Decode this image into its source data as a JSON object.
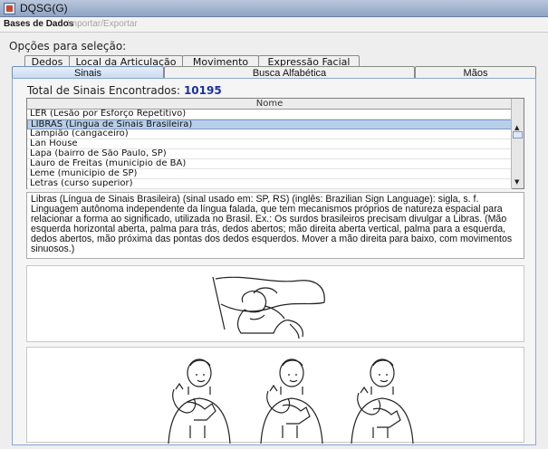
{
  "window": {
    "title": "DQSG(G)"
  },
  "menu": {
    "items": [
      "Bases de Dados",
      "Importar/Exportar"
    ]
  },
  "selection_label": "Opções para seleção:",
  "tabs_row1": [
    "Dedos",
    "Local da Articulação",
    "Movimento",
    "Expressão Facial"
  ],
  "tabs_row2": [
    "Sinais",
    "Busca Alfabética",
    "Mãos"
  ],
  "active_tab": "Sinais",
  "total": {
    "label": "Total de Sinais Encontrados:",
    "value": "10195"
  },
  "table": {
    "column": "Nome",
    "rows": [
      "LER (Lesão por Esforço Repetitivo)",
      "LIBRAS (Língua de Sinais Brasileira)",
      "Lampião (cangaceiro)",
      "Lan House",
      "Lapa (bairro de São Paulo, SP)",
      "Lauro de Freitas (município de BA)",
      "Leme (município de SP)",
      "Letras (curso superior)"
    ],
    "selected_index": 1
  },
  "definition": "Libras (Língua de Sinais Brasileira) (sinal usado em: SP, RS) (inglês: Brazilian Sign Language): sigla, s. f. Linguagem autônoma independente da língua falada, que tem mecanismos próprios de natureza espacial para relacionar a forma ao significado, utilizada no Brasil. Ex.: Os surdos brasileiros precisam divulgar a Libras. (Mão esquerda horizontal aberta, palma para trás, dedos abertos; mão direita aberta vertical, palma para a esquerda, dedos abertos, mão próxima das pontas dos dedos esquerdos. Mover a mão direita para baixo, com movimentos sinuosos.)",
  "colors": {
    "accent": "#1c2fa5",
    "selection": "#b8cfe9",
    "tab_active": "#c7d9ef"
  }
}
